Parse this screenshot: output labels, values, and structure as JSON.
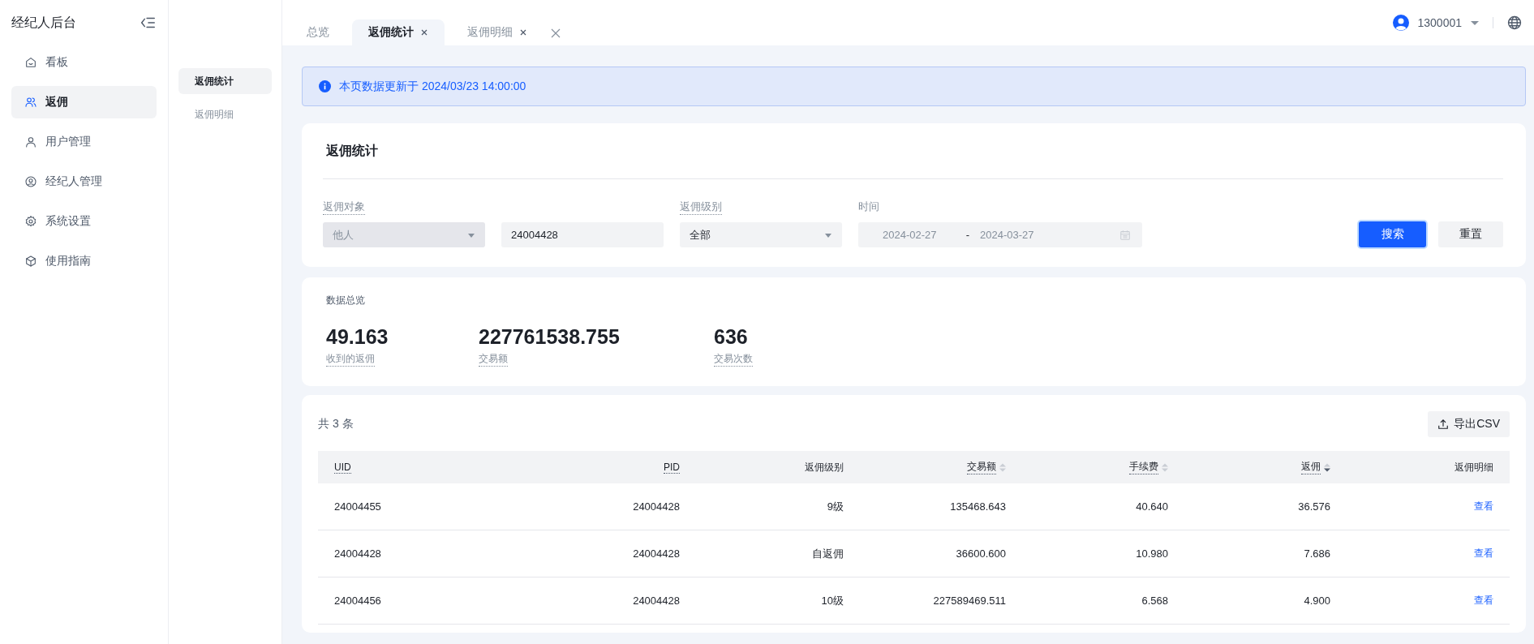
{
  "sidebar": {
    "title": "经纪人后台",
    "items": [
      {
        "label": "看板",
        "kind": "home",
        "selected": false
      },
      {
        "label": "返佣",
        "kind": "users",
        "selected": true
      },
      {
        "label": "用户管理",
        "kind": "user",
        "selected": false
      },
      {
        "label": "经纪人管理",
        "kind": "user-circle",
        "selected": false
      },
      {
        "label": "系统设置",
        "kind": "gear",
        "selected": false
      },
      {
        "label": "使用指南",
        "kind": "cube",
        "selected": false
      }
    ]
  },
  "submenu": {
    "items": [
      {
        "label": "返佣统计",
        "selected": true
      },
      {
        "label": "返佣明细",
        "selected": false
      }
    ]
  },
  "tabs": [
    {
      "label": "总览",
      "selected": false,
      "closable": false
    },
    {
      "label": "返佣统计",
      "selected": true,
      "closable": true
    },
    {
      "label": "返佣明细",
      "selected": false,
      "closable": true
    }
  ],
  "user": {
    "account": "1300001"
  },
  "alert": {
    "text": "本页数据更新于 2024/03/23 14:00:00"
  },
  "filter": {
    "title": "返佣统计",
    "fields": [
      {
        "kind": "select",
        "label": "返佣对象",
        "value": "他人",
        "disabled": true
      },
      {
        "kind": "input",
        "value": "24004428",
        "disabled": false
      },
      {
        "kind": "select",
        "label": "返佣级别",
        "value": "全部",
        "disabled": false
      },
      {
        "kind": "daterange",
        "label": "时间",
        "start": "2024-02-27",
        "separator": "-",
        "end": "2024-03-27"
      }
    ],
    "buttons": [
      {
        "label": "搜索",
        "kind": "primary"
      },
      {
        "label": "重置",
        "kind": "default"
      }
    ]
  },
  "overview": {
    "title": "数据总览",
    "stats": [
      {
        "value": "49.163",
        "label": "收到的返佣"
      },
      {
        "value": "227761538.755",
        "label": "交易额"
      },
      {
        "value": "636",
        "label": "交易次数"
      }
    ]
  },
  "table": {
    "count": "共 3 条",
    "export": "导出CSV",
    "columns": [
      {
        "label": "UID",
        "hint": true,
        "sortable": false
      },
      {
        "label": "PID",
        "hint": true,
        "sortable": false
      },
      {
        "label": "返佣级别",
        "hint": false,
        "sortable": false
      },
      {
        "label": "交易额",
        "hint": true,
        "sortable": true,
        "sorted_desc": false
      },
      {
        "label": "手续费",
        "hint": true,
        "sortable": true,
        "sorted_desc": false
      },
      {
        "label": "返佣",
        "hint": true,
        "sortable": true,
        "sorted_desc": true
      },
      {
        "label": "返佣明细",
        "hint": false,
        "sortable": false
      }
    ],
    "rows": [
      {
        "cells": [
          "24004455",
          "24004428",
          "9级",
          "135468.643",
          "40.640",
          "36.576"
        ],
        "link": "查看"
      },
      {
        "cells": [
          "24004428",
          "24004428",
          "自返佣",
          "36600.600",
          "10.980",
          "7.686"
        ],
        "link": "查看"
      },
      {
        "cells": [
          "24004456",
          "24004428",
          "10级",
          "227589469.511",
          "6.568",
          "4.900"
        ],
        "link": "查看"
      }
    ]
  }
}
